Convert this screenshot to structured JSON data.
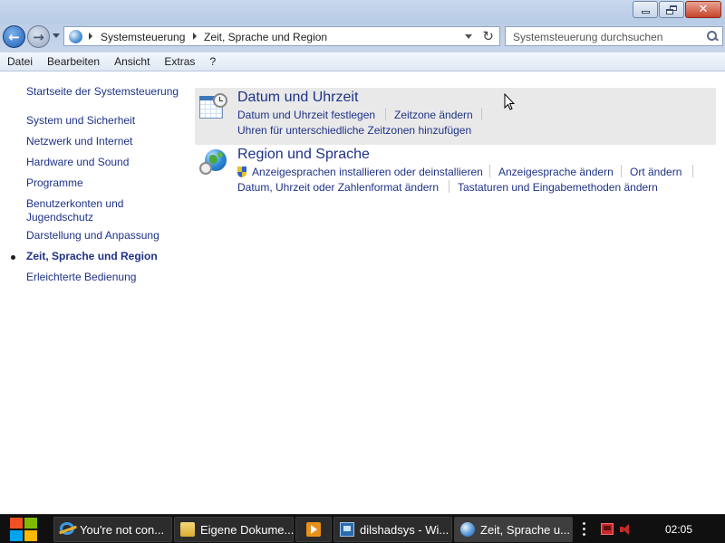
{
  "window": {
    "caption_buttons": [
      "minimize",
      "maximize",
      "close"
    ]
  },
  "navigation": {
    "breadcrumbs": [
      "Systemsteuerung",
      "Zeit, Sprache und Region"
    ],
    "search_placeholder": "Systemsteuerung durchsuchen"
  },
  "menu": {
    "items": [
      "Datei",
      "Bearbeiten",
      "Ansicht",
      "Extras",
      "?"
    ]
  },
  "sidebar": {
    "home_link": "Startseite der Systemsteuerung",
    "items": [
      {
        "label": "System und Sicherheit"
      },
      {
        "label": "Netzwerk und Internet"
      },
      {
        "label": "Hardware und Sound"
      },
      {
        "label": "Programme"
      },
      {
        "label": "Benutzerkonten und Jugendschutz",
        "line1": "Benutzerkonten und",
        "line2": "Jugendschutz"
      },
      {
        "label": "Darstellung und Anpassung"
      },
      {
        "label": "Zeit, Sprache und Region",
        "current": true
      },
      {
        "label": "Erleichterte Bedienung"
      }
    ]
  },
  "categories": [
    {
      "title": "Datum und Uhrzeit",
      "icon": "clock-calendar-icon",
      "links": [
        "Datum und Uhrzeit festlegen",
        "Zeitzone ändern",
        "Uhren für unterschiedliche Zeitzonen hinzufügen"
      ]
    },
    {
      "title": "Region und Sprache",
      "icon": "globe-icon",
      "links": [
        "Anzeigesprachen installieren oder deinstallieren",
        "Anzeigesprache ändern",
        "Ort ändern",
        "Datum, Uhrzeit oder Zahlenformat ändern",
        "Tastaturen und Eingabemethoden ändern"
      ]
    }
  ],
  "taskbar": {
    "buttons": [
      {
        "label": "You're not con...",
        "icon": "internet-explorer-icon"
      },
      {
        "label": "Eigene Dokume...",
        "icon": "folder-icon"
      },
      {
        "label": "",
        "icon": "media-player-icon"
      },
      {
        "label": "dilshadsys - Wi...",
        "icon": "virtual-machine-icon"
      },
      {
        "label": "Zeit, Sprache u...",
        "icon": "control-panel-icon",
        "active": true
      }
    ],
    "clock": "02:05"
  },
  "colors": {
    "link": "#1e3287",
    "hover_bg": "#e9e9e9",
    "titlebar": "#c9d8ec",
    "taskbar": "#101010"
  }
}
